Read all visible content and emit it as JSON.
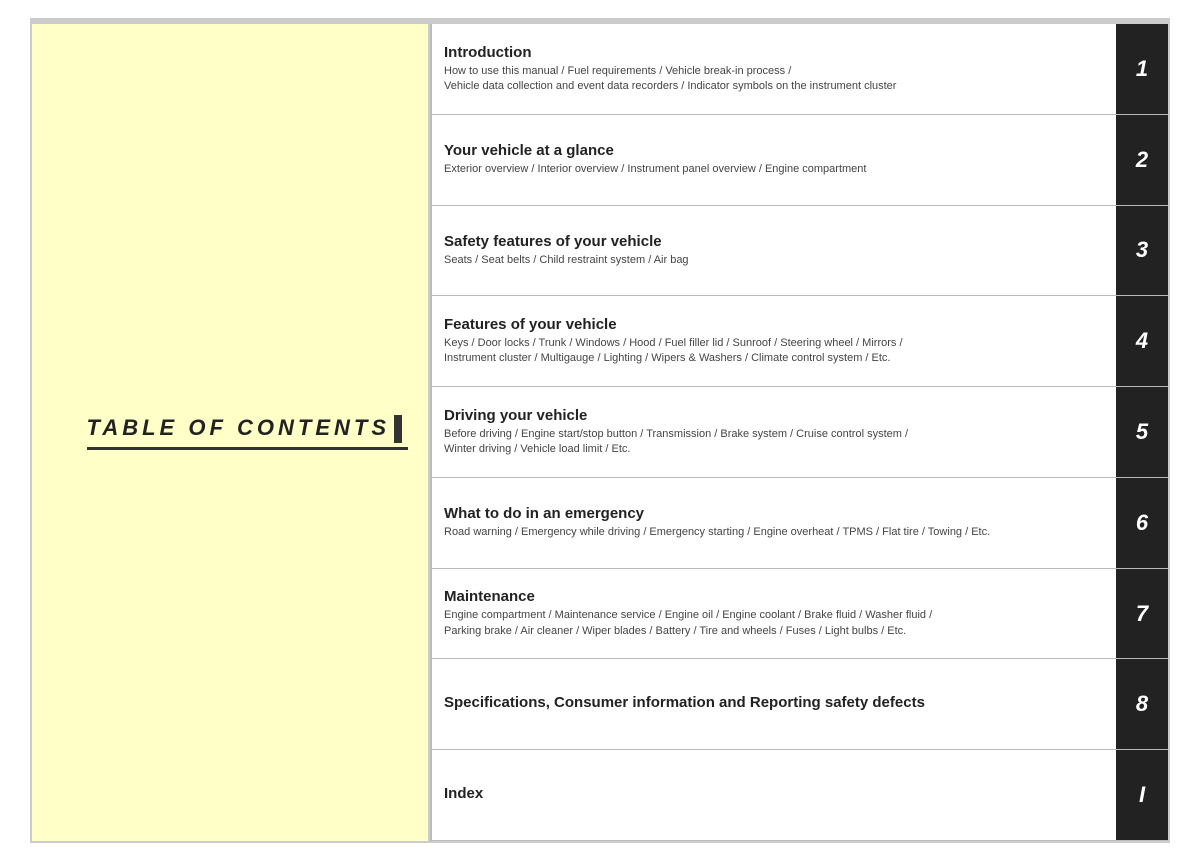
{
  "page": {
    "toc_title": "TABLE OF CONTENTS",
    "chapters": [
      {
        "id": "intro",
        "number": "1",
        "title": "Introduction",
        "description": "How to use this manual / Fuel requirements / Vehicle break-in process /\nVehicle data collection and event data recorders / Indicator symbols on the instrument cluster"
      },
      {
        "id": "glance",
        "number": "2",
        "title": "Your vehicle at a glance",
        "description": "Exterior overview / Interior overview / Instrument panel overview / Engine compartment"
      },
      {
        "id": "safety",
        "number": "3",
        "title": "Safety features of your vehicle",
        "description": "Seats / Seat belts / Child restraint system / Air bag"
      },
      {
        "id": "features",
        "number": "4",
        "title": "Features of your vehicle",
        "description": "Keys / Door locks / Trunk / Windows / Hood / Fuel filler lid / Sunroof / Steering wheel / Mirrors /\nInstrument cluster / Multigauge / Lighting / Wipers & Washers / Climate control system / Etc."
      },
      {
        "id": "driving",
        "number": "5",
        "title": "Driving your vehicle",
        "description": "Before driving / Engine start/stop button / Transmission / Brake system / Cruise control system /\nWinter driving / Vehicle load limit / Etc."
      },
      {
        "id": "emergency",
        "number": "6",
        "title": "What to do in an emergency",
        "description": "Road warning / Emergency while driving / Emergency starting / Engine overheat / TPMS / Flat tire / Towing / Etc."
      },
      {
        "id": "maintenance",
        "number": "7",
        "title": "Maintenance",
        "description": "Engine compartment / Maintenance service / Engine oil / Engine coolant / Brake fluid / Washer fluid /\nParking brake / Air cleaner / Wiper blades / Battery / Tire and wheels / Fuses / Light bulbs / Etc."
      },
      {
        "id": "specifications",
        "number": "8",
        "title": "Specifications, Consumer information and Reporting safety defects",
        "description": ""
      },
      {
        "id": "index",
        "number": "I",
        "title": "Index",
        "description": ""
      }
    ]
  }
}
